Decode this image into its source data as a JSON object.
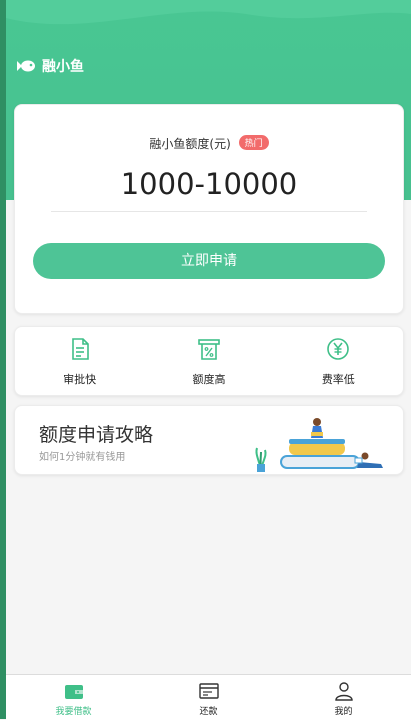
{
  "brand": {
    "name": "融小鱼"
  },
  "quota": {
    "label": "融小鱼额度(元)",
    "badge": "热门",
    "range": "1000-10000",
    "apply_label": "立即申请"
  },
  "features": [
    {
      "label": "审批快",
      "icon": "document-icon"
    },
    {
      "label": "额度高",
      "icon": "percent-receipt-icon"
    },
    {
      "label": "费率低",
      "icon": "yuan-circle-icon"
    }
  ],
  "strategy": {
    "title": "额度申请攻略",
    "subtitle": "如何1分钟就有钱用"
  },
  "tabbar": [
    {
      "label": "我要借款",
      "icon": "wallet-icon",
      "active": true
    },
    {
      "label": "还款",
      "icon": "bill-icon",
      "active": false
    },
    {
      "label": "我的",
      "icon": "user-icon",
      "active": false
    }
  ],
  "colors": {
    "primary": "#49c793",
    "badge": "#f26b6b",
    "accent": "#3fbf88"
  }
}
